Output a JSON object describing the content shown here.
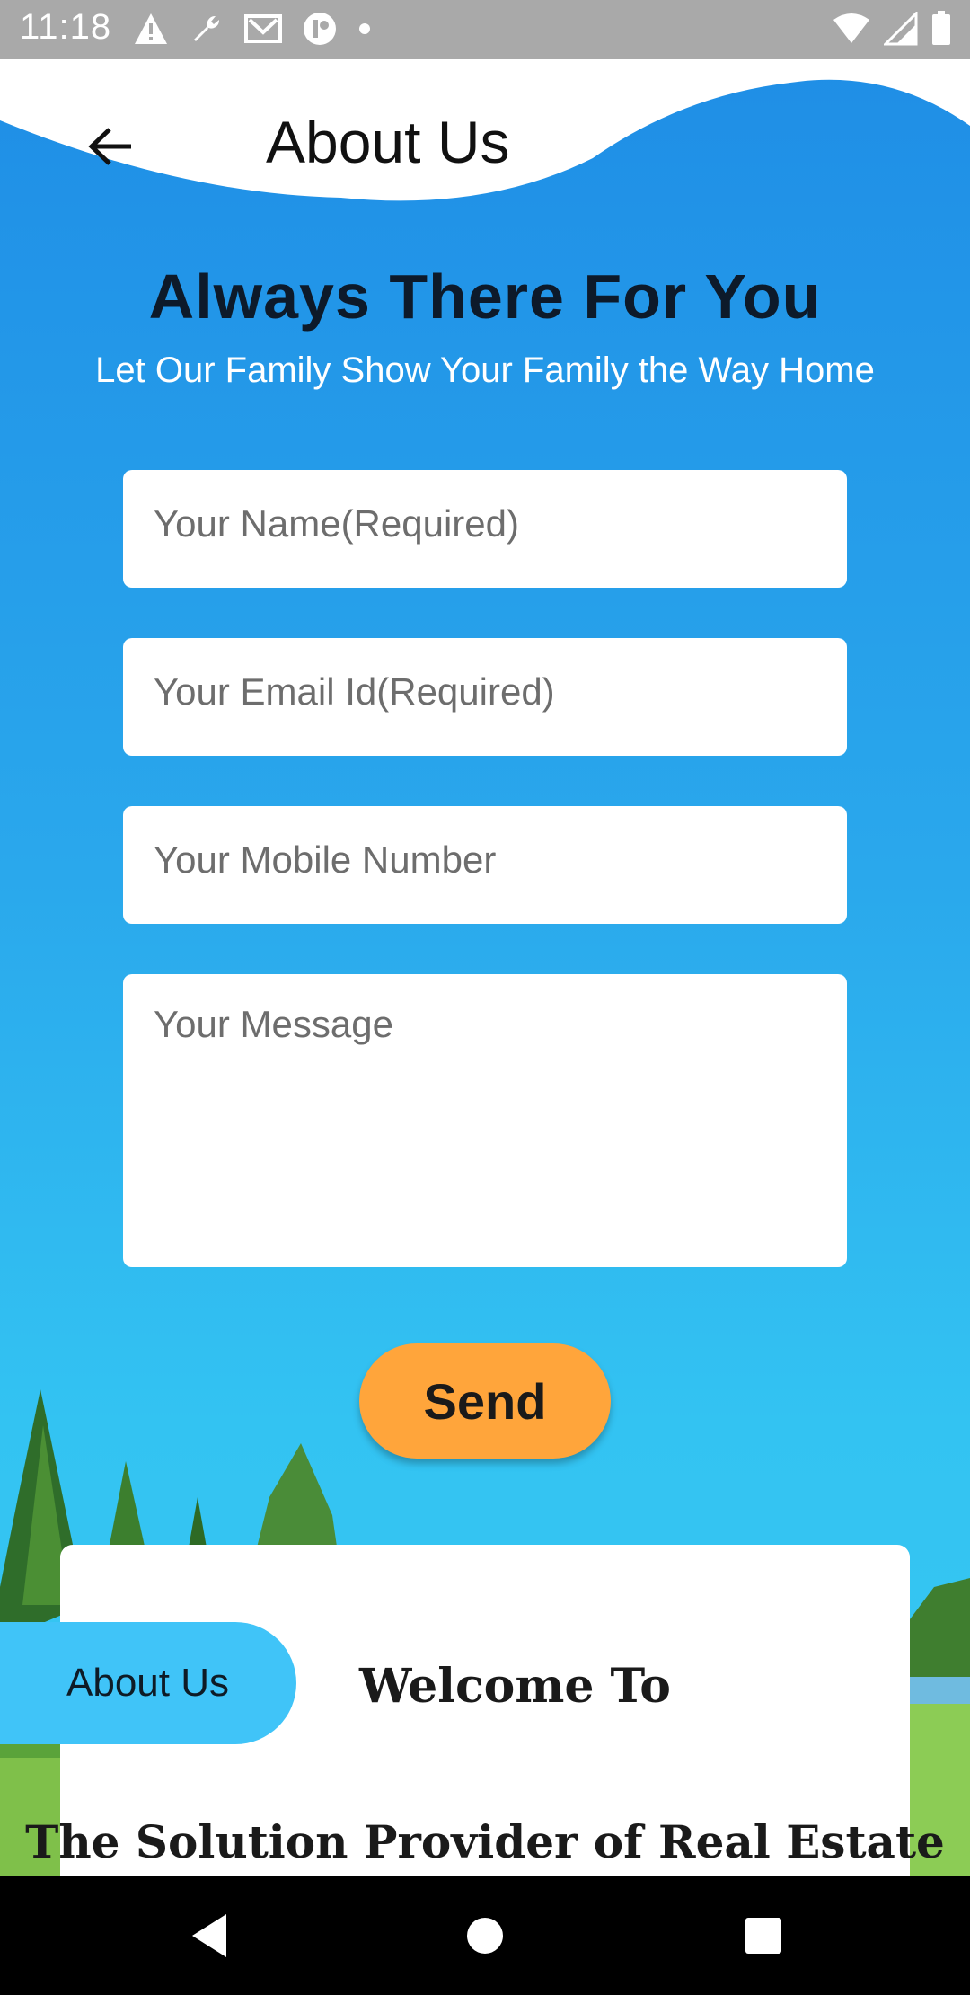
{
  "status_bar": {
    "time": "11:18",
    "left_icons": [
      "warning-icon",
      "wrench-icon",
      "mail-icon",
      "app-icon",
      "dot-icon"
    ],
    "right_icons": [
      "wifi-icon",
      "signal-icon",
      "battery-icon"
    ]
  },
  "header": {
    "title": "About Us",
    "back_icon": "arrow-left-icon"
  },
  "hero": {
    "title": "Always There For You",
    "subtitle": "Let Our Family Show Your Family the Way Home"
  },
  "form": {
    "name_placeholder": "Your Name(Required)",
    "email_placeholder": "Your Email Id(Required)",
    "mobile_placeholder": "Your Mobile Number",
    "message_placeholder": "Your Message",
    "send_label": "Send"
  },
  "about_section": {
    "pill_label": "About Us",
    "welcome": "Welcome To",
    "solution": "The Solution Provider of Real Estate"
  },
  "nav": {
    "icons": [
      "back-triangle-icon",
      "home-circle-icon",
      "recents-square-icon"
    ]
  },
  "colors": {
    "accent_blue": "#1f8ee6",
    "send_orange": "#ffa53b",
    "pill_blue": "#40c4f8"
  }
}
